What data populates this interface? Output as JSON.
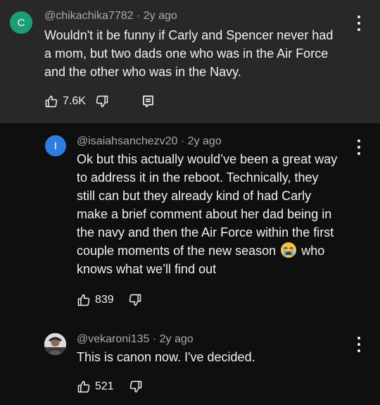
{
  "colors": {
    "main_bg": "#282828",
    "page_bg": "#0f0f0f",
    "avatar_c": "#1b9e74",
    "avatar_i": "#2f7de1"
  },
  "main_comment": {
    "avatar_letter": "C",
    "author": "@chikachika7782",
    "separator": "·",
    "age": "2y ago",
    "lines": [
      "Wouldn't it be funny if Carly and Spencer never had",
      "a mom, but two dads one who was in the Air Force",
      "and the other who was in the Navy."
    ],
    "likes": "7.6K",
    "icons": [
      "thumbs-up-icon",
      "thumbs-down-icon",
      "reply-icon",
      "more-vert-icon"
    ]
  },
  "replies": [
    {
      "avatar_letter": "I",
      "author": "@isaiahsanchezv20",
      "separator": "·",
      "age": "2y ago",
      "lines": [
        "Ok but this actually would’ve been a great way",
        "to address it in the reboot. Technically, they",
        "still can but they already kind of had Carly",
        "make a brief comment about her dad being in",
        "the navy and then the Air Force within the first",
        "couple moments of the new season",
        "who",
        "knows what we’ll find out"
      ],
      "emoji": "loudly-crying-face",
      "likes": "839"
    },
    {
      "author": "@vekaroni135",
      "separator": "·",
      "age": "2y ago",
      "lines": [
        "This is canon now. I've decided."
      ],
      "likes": "521"
    }
  ]
}
